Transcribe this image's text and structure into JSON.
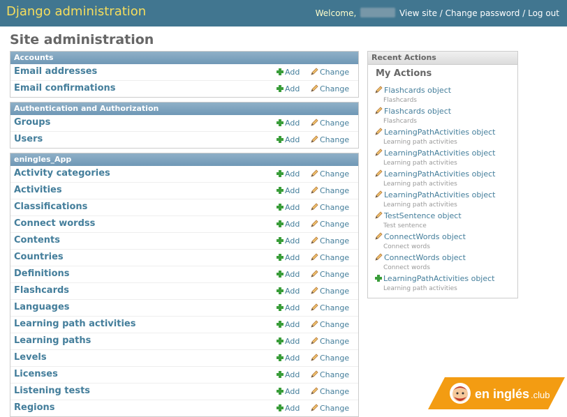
{
  "header": {
    "branding": "Django administration",
    "welcome": "Welcome,",
    "view_site": "View site",
    "change_password": "Change password",
    "logout": "Log out",
    "sep": "/"
  },
  "page_title": "Site administration",
  "modules": [
    {
      "caption": "Accounts",
      "models": [
        "Email addresses",
        "Email confirmations"
      ]
    },
    {
      "caption": "Authentication and Authorization",
      "models": [
        "Groups",
        "Users"
      ]
    },
    {
      "caption": "eningles_App",
      "models": [
        "Activity categories",
        "Activities",
        "Classifications",
        "Connect wordss",
        "Contents",
        "Countries",
        "Definitions",
        "Flashcards",
        "Languages",
        "Learning path activities",
        "Learning paths",
        "Levels",
        "Licenses",
        "Listening tests",
        "Regions"
      ]
    }
  ],
  "links": {
    "add": "Add",
    "change": "Change"
  },
  "recent": {
    "caption": "Recent Actions",
    "my_actions": "My Actions",
    "items": [
      {
        "label": "Flashcards object",
        "type": "Flashcards",
        "icon": "pencil-icon"
      },
      {
        "label": "Flashcards object",
        "type": "Flashcards",
        "icon": "pencil-icon"
      },
      {
        "label": "LearningPathActivities object",
        "type": "Learning path activities",
        "icon": "pencil-icon"
      },
      {
        "label": "LearningPathActivities object",
        "type": "Learning path activities",
        "icon": "pencil-icon"
      },
      {
        "label": "LearningPathActivities object",
        "type": "Learning path activities",
        "icon": "pencil-icon"
      },
      {
        "label": "LearningPathActivities object",
        "type": "Learning path activities",
        "icon": "pencil-icon"
      },
      {
        "label": "TestSentence object",
        "type": "Test sentence",
        "icon": "pencil-icon"
      },
      {
        "label": "ConnectWords object",
        "type": "Connect words",
        "icon": "pencil-icon"
      },
      {
        "label": "ConnectWords object",
        "type": "Connect words",
        "icon": "pencil-icon"
      },
      {
        "label": "LearningPathActivities object",
        "type": "Learning path activities",
        "icon": "plus-icon"
      }
    ]
  },
  "logo": {
    "text": "en inglés",
    "suffix": ".club"
  },
  "colors": {
    "header": "#417690",
    "branding": "#f5dd5d",
    "link": "#447e9b",
    "module_caption": "#79aec8",
    "logo_orange": "#f39c12"
  }
}
